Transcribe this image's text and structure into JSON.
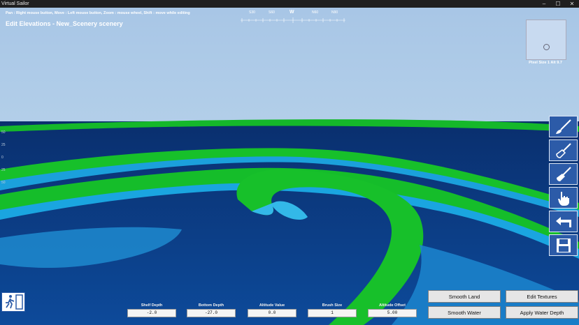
{
  "window": {
    "title": "Virtual Sailor",
    "controls": [
      "–",
      "☐",
      "✕"
    ]
  },
  "hint": "Pan : Right mouse button, Move : Left mouse button, Zoom : mouse wheel, Shift : move while editing",
  "mode_title": "Edit Elevations - New_Scenery scenery",
  "compass": {
    "labels": [
      "S30",
      "S60",
      "W",
      "N60",
      "N90"
    ],
    "current": "W"
  },
  "pixel_info": "Pixel Size 1 Alt 9.7",
  "tools": [
    {
      "name": "brush-tool",
      "icon": "paintbrush-icon"
    },
    {
      "name": "raise-tool",
      "icon": "shovel-icon"
    },
    {
      "name": "lower-tool",
      "icon": "spade-icon"
    },
    {
      "name": "hand-tool",
      "icon": "hand-pointer-icon"
    },
    {
      "name": "undo-tool",
      "icon": "undo-arrow-icon"
    },
    {
      "name": "save-tool",
      "icon": "floppy-disk-icon"
    }
  ],
  "fields": [
    {
      "label": "Shelf Depth",
      "value": "-2.0"
    },
    {
      "label": "Bottom Depth",
      "value": "-27.0"
    },
    {
      "label": "Altitude Value",
      "value": "0.0"
    },
    {
      "label": "Brush Size",
      "value": "1"
    },
    {
      "label": "Altitude Offset",
      "value": "5.00"
    }
  ],
  "buttons": {
    "smooth_land": "Smooth Land",
    "edit_textures": "Edit Textures",
    "smooth_water": "Smooth Water",
    "apply_water_depth": "Apply Water Depth"
  },
  "left_marks": [
    "50",
    "25",
    "0",
    "25",
    "50"
  ],
  "colors": {
    "sky": "#a9c7e6",
    "deep_water": "#0b3c80",
    "shallow_water": "#1aa3e0",
    "land": "#16c026",
    "tool_bg": "#2c5ba8"
  }
}
